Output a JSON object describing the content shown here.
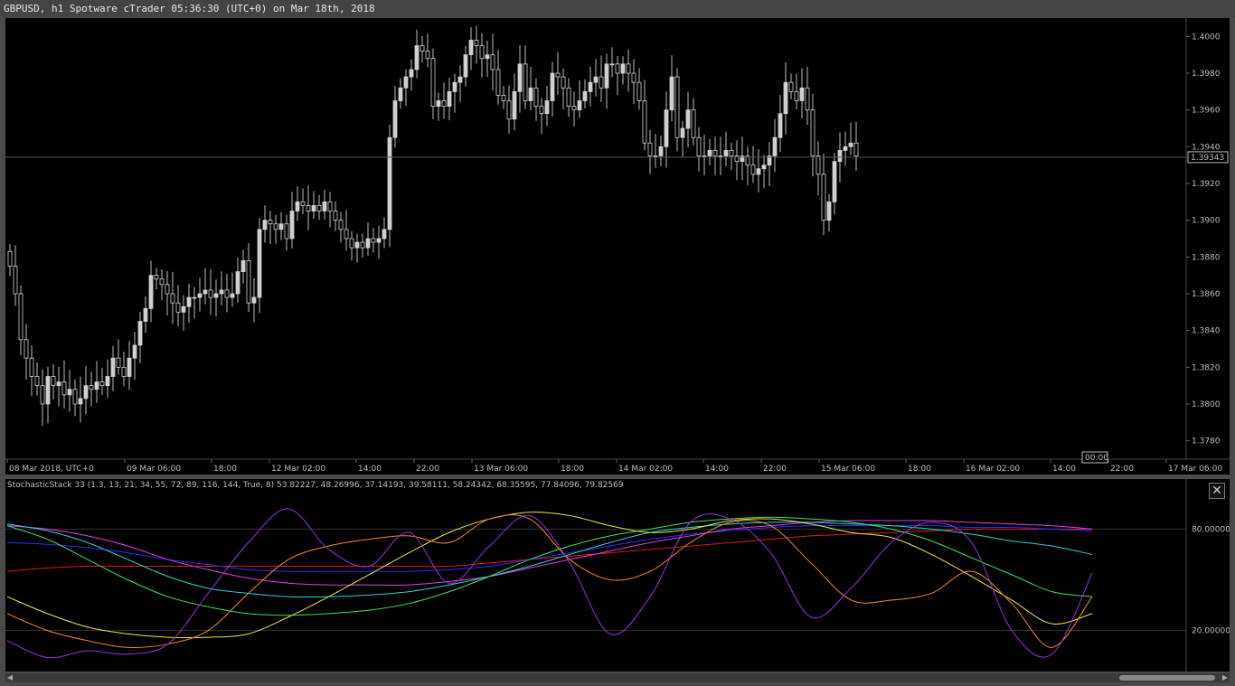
{
  "window": {
    "title": "GBPUSD, h1 Spotware cTrader 05:36:30 (UTC+0) on Mar 18th, 2018"
  },
  "main_chart": {
    "price_labels": [
      "1.4000",
      "1.3980",
      "1.3960",
      "1.3940",
      "1.3920",
      "1.3900",
      "1.3880",
      "1.3860",
      "1.3840",
      "1.3820",
      "1.3800",
      "1.3780"
    ],
    "current_price": "1.39343",
    "time_labels": [
      "08 Mar 2018, UTC+0",
      "09 Mar 06:00",
      "18:00",
      "12 Mar 02:00",
      "14:00",
      "22:00",
      "13 Mar 06:00",
      "18:00",
      "14 Mar 02:00",
      "14:00",
      "22:00",
      "15 Mar 06:00",
      "18:00",
      "16 Mar 02:00",
      "14:00",
      "22:00",
      "17 Mar 06:00"
    ],
    "cursor_time": "00:00"
  },
  "indicator": {
    "label": "StochasticStack 33 (1.3, 13, 21, 34, 55, 72, 89, 116, 144, True, 8) 53.82227, 48.26996, 37.14193, 39.58111, 58.24342, 68.35595, 77.84096, 79.82569",
    "levels": [
      "80.00000",
      "20.00000"
    ],
    "close_icon": "close-icon"
  },
  "chart_data": [
    {
      "type": "candlestick",
      "title": "GBPUSD, h1",
      "ylim": [
        1.377,
        1.401
      ],
      "current_price": 1.39343,
      "candle_color": "#d0d0d0",
      "closes": [
        1.3875,
        1.386,
        1.3835,
        1.3825,
        1.3815,
        1.381,
        1.38,
        1.3815,
        1.381,
        1.3812,
        1.3805,
        1.3808,
        1.38,
        1.3803,
        1.381,
        1.3808,
        1.3812,
        1.381,
        1.3815,
        1.3825,
        1.382,
        1.3815,
        1.3825,
        1.3832,
        1.3845,
        1.3852,
        1.387,
        1.3868,
        1.3865,
        1.386,
        1.3855,
        1.385,
        1.3853,
        1.3858,
        1.3858,
        1.386,
        1.3862,
        1.3858,
        1.386,
        1.3862,
        1.3858,
        1.386,
        1.3872,
        1.3878,
        1.3855,
        1.3858,
        1.3895,
        1.39,
        1.3898,
        1.3895,
        1.3898,
        1.389,
        1.3905,
        1.391,
        1.3908,
        1.3905,
        1.3908,
        1.3905,
        1.391,
        1.3905,
        1.39,
        1.3895,
        1.389,
        1.3885,
        1.3888,
        1.3885,
        1.389,
        1.3888,
        1.389,
        1.3895,
        1.3945,
        1.3965,
        1.3972,
        1.3978,
        1.3982,
        1.3995,
        1.3992,
        1.3988,
        1.3962,
        1.3965,
        1.3962,
        1.397,
        1.3975,
        1.3978,
        1.399,
        1.3998,
        1.3995,
        1.3988,
        1.399,
        1.3982,
        1.3968,
        1.3965,
        1.3955,
        1.397,
        1.3985,
        1.3965,
        1.3972,
        1.3962,
        1.3958,
        1.3965,
        1.398,
        1.3978,
        1.3972,
        1.3962,
        1.396,
        1.3965,
        1.397,
        1.3975,
        1.3978,
        1.3972,
        1.3985,
        1.3985,
        1.398,
        1.3985,
        1.398,
        1.3975,
        1.3965,
        1.3942,
        1.3935,
        1.3935,
        1.394,
        1.396,
        1.3978,
        1.3945,
        1.395,
        1.396,
        1.3945,
        1.3935,
        1.3935,
        1.3938,
        1.3935,
        1.3935,
        1.3938,
        1.3935,
        1.3932,
        1.3935,
        1.393,
        1.3925,
        1.3928,
        1.393,
        1.3935,
        1.3945,
        1.3958,
        1.3975,
        1.397,
        1.3965,
        1.3972,
        1.396,
        1.3935,
        1.3925,
        1.39,
        1.391,
        1.3932,
        1.3938,
        1.394,
        1.3942,
        1.3935
      ]
    },
    {
      "type": "line",
      "title": "StochasticStack 33",
      "ylim": [
        0,
        100
      ],
      "levels": [
        80,
        20
      ],
      "x": [
        0,
        8,
        16,
        24,
        32,
        40,
        48,
        56,
        64,
        72,
        80,
        88,
        96,
        104,
        112,
        120,
        128,
        136,
        144,
        152,
        160,
        168,
        176,
        184,
        192,
        200,
        208,
        216
      ],
      "series": [
        {
          "color": "#e01a1a",
          "values": [
            55,
            57,
            58,
            58,
            58,
            58,
            58,
            58,
            58,
            58,
            58,
            58,
            60,
            62,
            64,
            66,
            68,
            70,
            72,
            74,
            76,
            77,
            78,
            79,
            80,
            80,
            80,
            80
          ]
        },
        {
          "color": "#2b2bff",
          "values": [
            72,
            71,
            69,
            66,
            62,
            59,
            56,
            55,
            55,
            55,
            55,
            56,
            58,
            62,
            66,
            70,
            74,
            77,
            79,
            81,
            82,
            82,
            82,
            82,
            81,
            81,
            80,
            79
          ]
        },
        {
          "color": "#e040e0",
          "values": [
            82,
            80,
            76,
            70,
            62,
            56,
            51,
            48,
            47,
            47,
            47,
            49,
            52,
            57,
            62,
            67,
            72,
            76,
            80,
            82,
            84,
            85,
            85,
            85,
            84,
            83,
            82,
            80
          ]
        },
        {
          "color": "#30d0d0",
          "values": [
            83,
            79,
            72,
            62,
            52,
            45,
            42,
            40,
            40,
            41,
            43,
            47,
            52,
            58,
            65,
            72,
            78,
            81,
            83,
            84,
            84,
            83,
            82,
            80,
            77,
            73,
            70,
            65
          ]
        },
        {
          "color": "#40e060",
          "values": [
            82,
            74,
            62,
            50,
            40,
            34,
            30,
            29,
            30,
            32,
            36,
            43,
            52,
            62,
            70,
            76,
            80,
            84,
            86,
            87,
            86,
            84,
            80,
            73,
            63,
            53,
            43,
            40
          ]
        },
        {
          "color": "#e8e840",
          "values": [
            40,
            30,
            22,
            18,
            16,
            16,
            18,
            28,
            40,
            53,
            66,
            78,
            86,
            90,
            88,
            82,
            78,
            80,
            85,
            86,
            83,
            78,
            75,
            65,
            52,
            38,
            24,
            30
          ]
        },
        {
          "color": "#f08a2a",
          "values": [
            30,
            20,
            14,
            10,
            12,
            20,
            42,
            62,
            70,
            74,
            76,
            72,
            86,
            86,
            62,
            50,
            55,
            72,
            84,
            82,
            60,
            38,
            38,
            42,
            55,
            36,
            10,
            40
          ]
        },
        {
          "color": "#9a30e0",
          "values": [
            14,
            4,
            8,
            6,
            12,
            42,
            72,
            92,
            68,
            58,
            78,
            48,
            70,
            88,
            60,
            18,
            40,
            84,
            86,
            66,
            28,
            45,
            72,
            84,
            72,
            20,
            6,
            54
          ]
        }
      ]
    }
  ]
}
